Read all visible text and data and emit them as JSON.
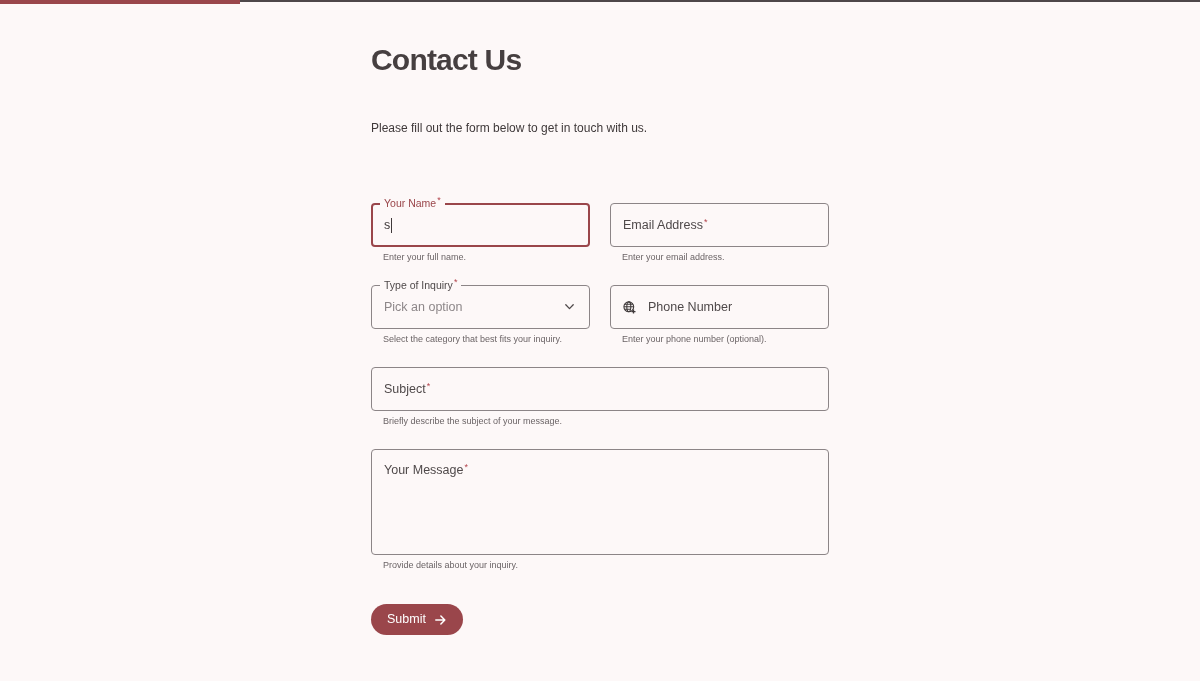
{
  "progress_bar": {
    "level": 0.2
  },
  "title": "Contact Us",
  "intro": "Please fill out the form below to get in touch with us.",
  "form_rows": [
    [
      {
        "kind": "text",
        "label": "Your Name$^{*}$",
        "value": "s",
        "focused": true,
        "helper": "Enter your full name."
      },
      {
        "kind": "text",
        "label": "Email Address$^{*}$",
        "focused": false,
        "helper": "Enter your email address."
      }
    ],
    [
      {
        "kind": "select",
        "label": "Type of Inquiry$^{*}$",
        "placeholder": "Pick an option",
        "focused": false,
        "helper": "Select the category that best fits your inquiry."
      },
      {
        "kind": "phone",
        "label": "Phone Number",
        "focused": false,
        "helper": "Enter your phone number (optional)."
      }
    ],
    [
      {
        "kind": "text",
        "label": "Subject$^{*}$",
        "focused": false,
        "helper": "Briefly describe the subject of your message."
      }
    ],
    [
      {
        "kind": "textarea",
        "label": "Your Message$^{*}$",
        "focused": false,
        "helper": "Provide details about your inquiry."
      }
    ]
  ],
  "submit_button": {
    "label": "Submit"
  }
}
